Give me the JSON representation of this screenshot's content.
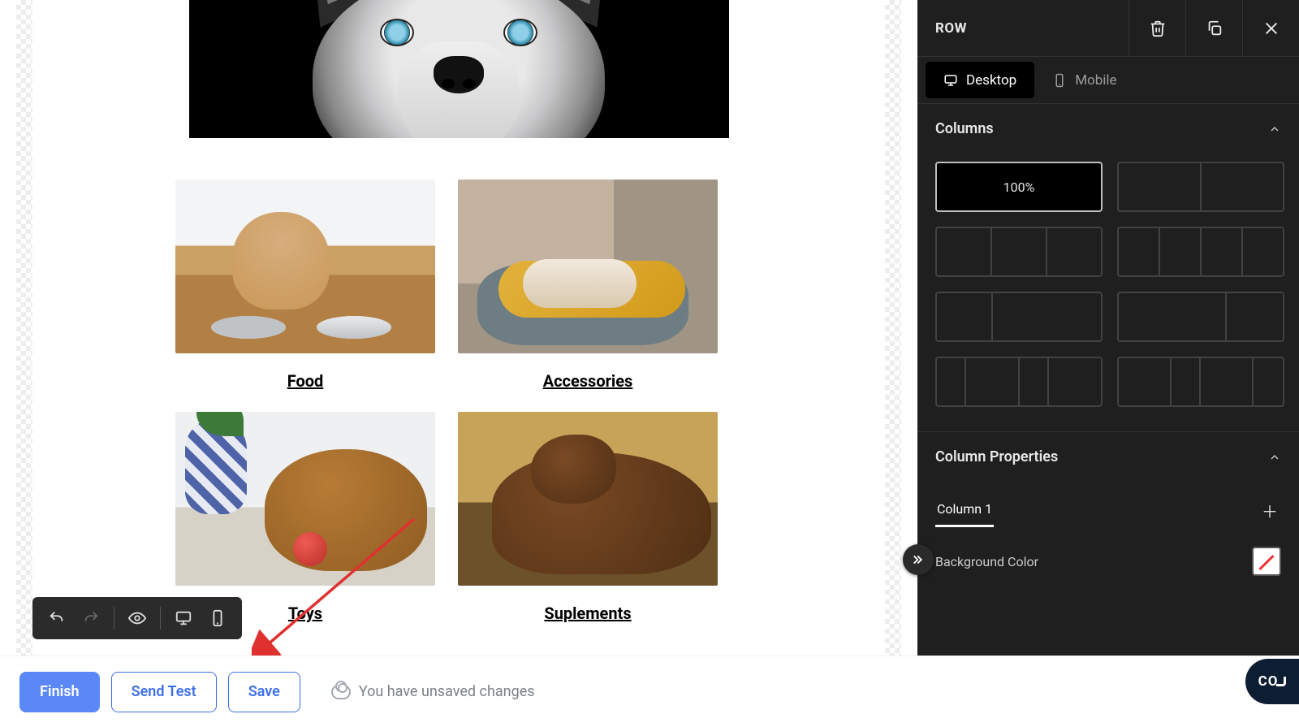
{
  "categories": {
    "food": "Food",
    "accessories": "Accessories",
    "toys": "Toys",
    "supplements": "Suplements"
  },
  "toolbar": {
    "finish": "Finish",
    "send_test": "Send Test",
    "save": "Save",
    "status": "You have unsaved changes"
  },
  "panel": {
    "title": "ROW",
    "device_desktop": "Desktop",
    "device_mobile": "Mobile",
    "columns_section": "Columns",
    "col_100": "100%",
    "column_props": "Column Properties",
    "col1": "Column 1",
    "bg_color": "Background Color"
  },
  "co_badge": "CO"
}
